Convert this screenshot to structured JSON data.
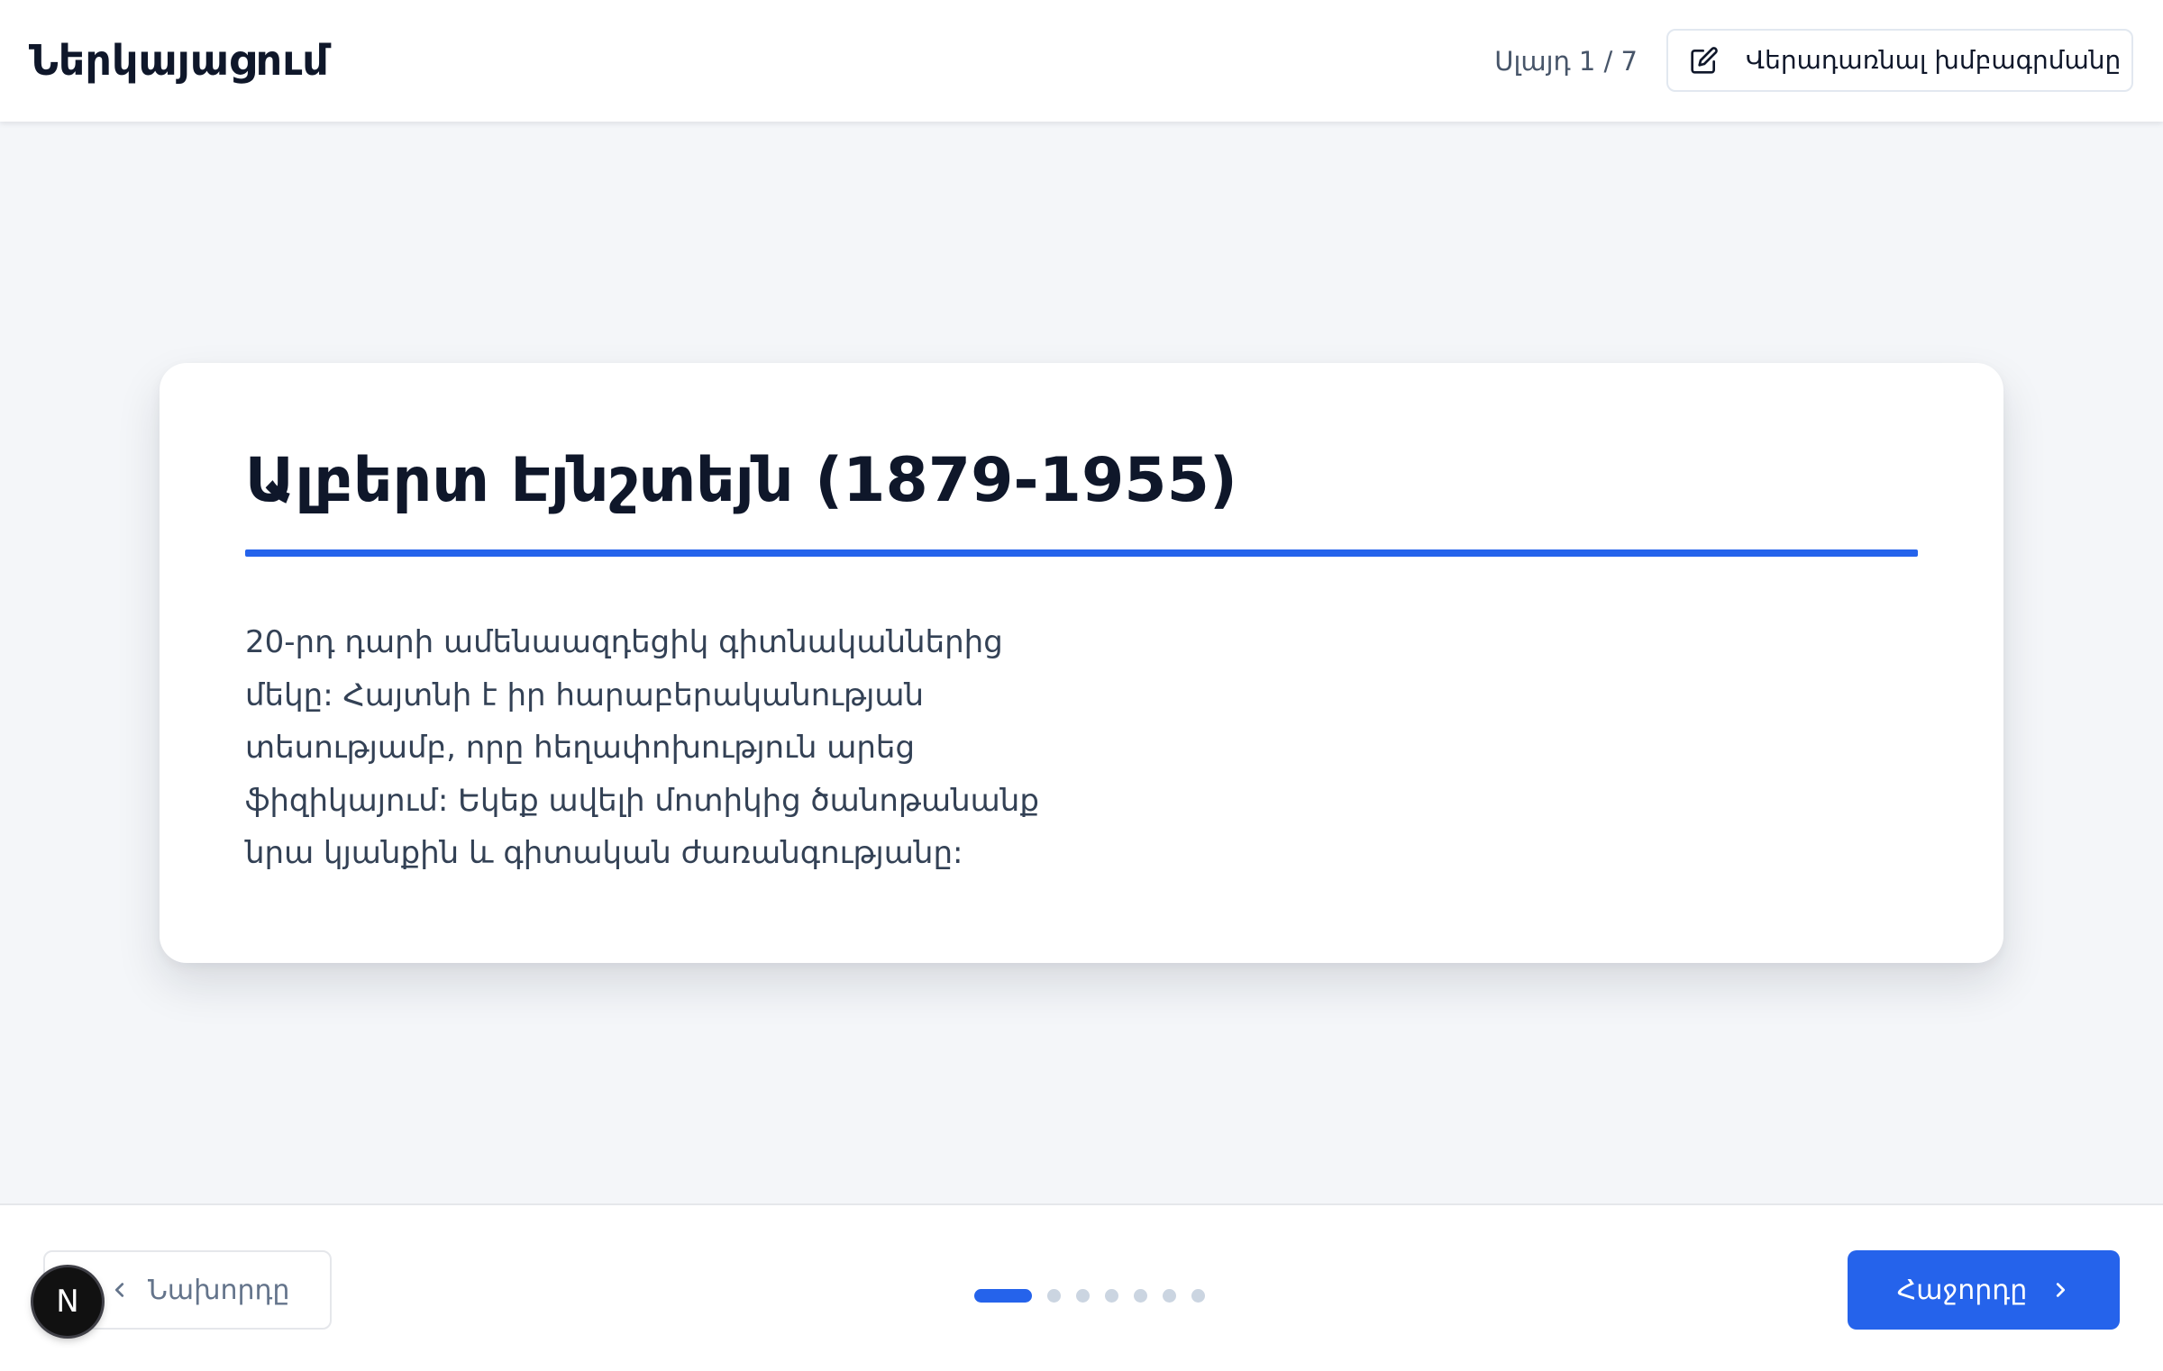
{
  "header": {
    "title": "Ներկայացում",
    "page_indicator": "Սլայդ 1 / 7",
    "edit_button_label": "Վերադառնալ խմբագրմանը",
    "edit_icon": "edit-icon"
  },
  "slide": {
    "title": "Ալբերտ Էյնշտեյն (1879-1955)",
    "body_lines": [
      "20-րդ դարի ամենաազդեցիկ գիտնականներից",
      "մեկը: Հայտնի է իր հարաբերականության",
      "տեսությամբ, որը հեղափոխություն արեց",
      "ֆիզիկայում: Եկեք ավելի մոտիկից ծանոթանանք",
      "նրա կյանքին և գիտական ժառանգությանը:"
    ],
    "accent_color": "#2563eb"
  },
  "footer": {
    "prev_label": "Նախորդը",
    "next_label": "Հաջորդը",
    "current_slide": 1,
    "total_slides": 7
  },
  "badge": {
    "letter": "N"
  }
}
